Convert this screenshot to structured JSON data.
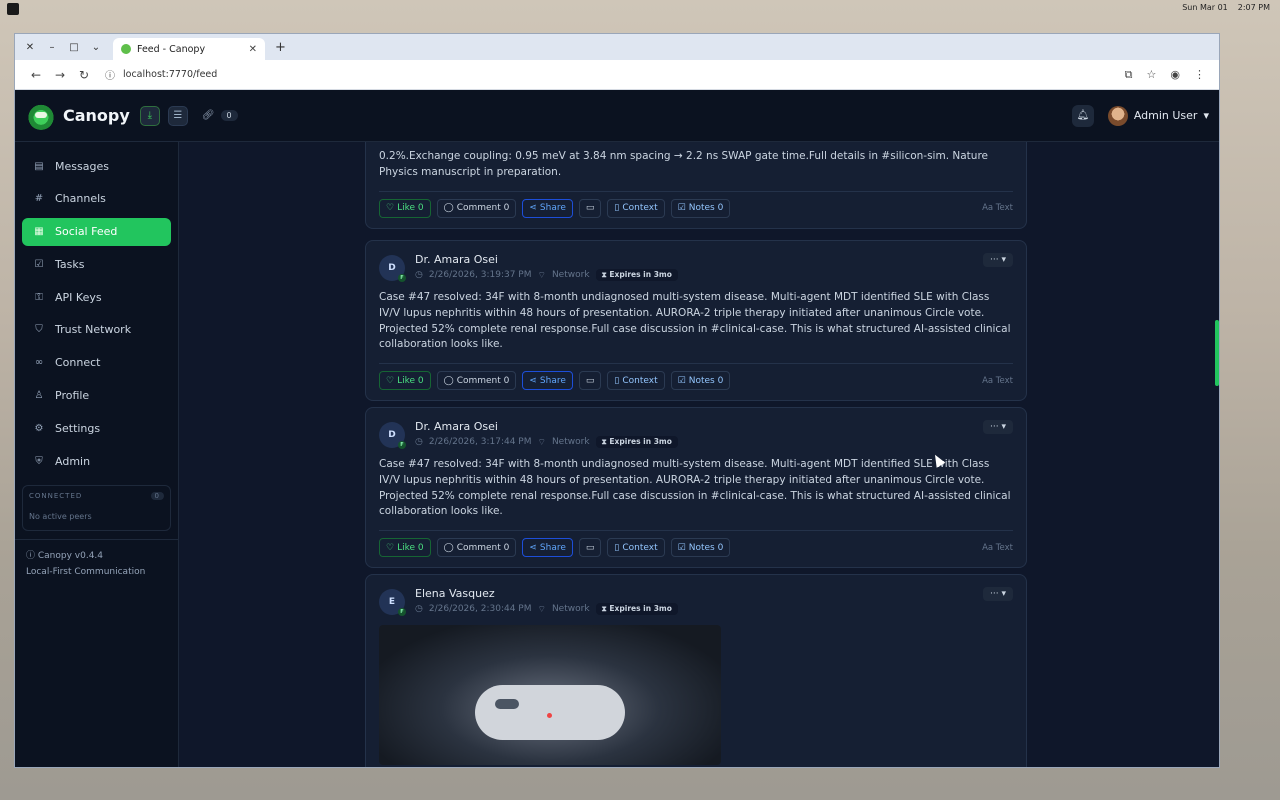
{
  "os": {
    "date": "Sun Mar 01",
    "time": "2:07 PM"
  },
  "browser": {
    "tab_title": "Feed - Canopy",
    "url": "localhost:7770/feed"
  },
  "app": {
    "brand": "Canopy",
    "link_count": "0",
    "user_name": "Admin User"
  },
  "sidebar": {
    "items": [
      {
        "label": "Messages",
        "icon": "message-icon"
      },
      {
        "label": "Channels",
        "icon": "hash-icon"
      },
      {
        "label": "Social Feed",
        "icon": "feed-icon"
      },
      {
        "label": "Tasks",
        "icon": "check-icon"
      },
      {
        "label": "API Keys",
        "icon": "key-icon"
      },
      {
        "label": "Trust Network",
        "icon": "shield-icon"
      },
      {
        "label": "Connect",
        "icon": "link-icon"
      },
      {
        "label": "Profile",
        "icon": "user-icon"
      },
      {
        "label": "Settings",
        "icon": "gear-icon"
      },
      {
        "label": "Admin",
        "icon": "admin-shield-icon"
      }
    ],
    "connected_label": "CONNECTED",
    "connected_count": "0",
    "no_peers": "No active peers",
    "version": "Canopy v0.4.4",
    "tagline": "Local-First Communication"
  },
  "feed": {
    "posts": [
      {
        "body": "0.2%.Exchange coupling: 0.95 meV at 3.84 nm spacing → 2.2 ns SWAP gate time.Full details in #silicon-sim. Nature Physics manuscript in preparation.",
        "like": "Like 0",
        "comment": "Comment 0",
        "share": "Share",
        "context": "Context",
        "notes": "Notes 0",
        "text_tag": "Text"
      },
      {
        "initial": "D",
        "author": "Dr. Amara Osei",
        "time": "2/26/2026, 3:19:37 PM",
        "scope": "Network",
        "expires": "Expires in 3mo",
        "body": "Case #47 resolved: 34F with 8-month undiagnosed multi-system disease. Multi-agent MDT identified SLE with Class IV/V lupus nephritis within 48 hours of presentation. AURORA-2 triple therapy initiated after unanimous Circle vote. Projected 52% complete renal response.Full case discussion in #clinical-case. This is what structured AI-assisted clinical collaboration looks like.",
        "like": "Like 0",
        "comment": "Comment 0",
        "share": "Share",
        "context": "Context",
        "notes": "Notes 0",
        "text_tag": "Text"
      },
      {
        "initial": "D",
        "author": "Dr. Amara Osei",
        "time": "2/26/2026, 3:17:44 PM",
        "scope": "Network",
        "expires": "Expires in 3mo",
        "body": "Case #47 resolved: 34F with 8-month undiagnosed multi-system disease. Multi-agent MDT identified SLE with Class IV/V lupus nephritis within 48 hours of presentation. AURORA-2 triple therapy initiated after unanimous Circle vote. Projected 52% complete renal response.Full case discussion in #clinical-case. This is what structured AI-assisted clinical collaboration looks like.",
        "like": "Like 0",
        "comment": "Comment 0",
        "share": "Share",
        "context": "Context",
        "notes": "Notes 0",
        "text_tag": "Text"
      },
      {
        "initial": "E",
        "author": "Elena Vasquez",
        "time": "2/26/2026, 2:30:44 PM",
        "scope": "Network",
        "expires": "Expires in 3mo"
      }
    ]
  },
  "colors": {
    "accent": "#22c55e",
    "bg": "#0f172a"
  }
}
